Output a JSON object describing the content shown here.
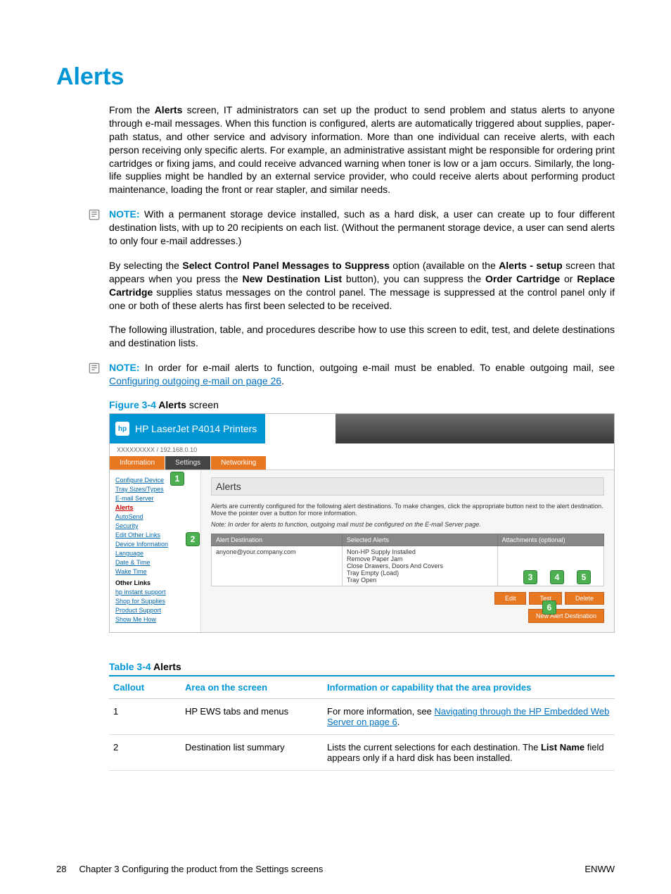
{
  "page_title": "Alerts",
  "paragraphs": {
    "p1_a": "From the ",
    "p1_b": "Alerts",
    "p1_c": " screen, IT administrators can set up the product to send problem and status alerts to anyone through e-mail messages. When this function is configured, alerts are automatically triggered about supplies, paper-path status, and other service and advisory information. More than one individual can receive alerts, with each person receiving only specific alerts. For example, an administrative assistant might be responsible for ordering print cartridges or fixing jams, and could receive advanced warning when toner is low or a jam occurs. Similarly, the long-life supplies might be handled by an external service provider, who could receive alerts about performing product maintenance, loading the front or rear stapler, and similar needs.",
    "note1_label": "NOTE:",
    "note1_text": "  With a permanent storage device installed, such as a hard disk, a user can create up to four different destination lists, with up to 20 recipients on each list. (Without the permanent storage device, a user can send alerts to only four e-mail addresses.)",
    "p2_a": "By selecting the ",
    "p2_b": "Select Control Panel Messages to Suppress",
    "p2_c": " option (available on the ",
    "p2_d": "Alerts - setup",
    "p2_e": " screen that appears when you press the ",
    "p2_f": "New Destination List",
    "p2_g": " button), you can suppress the ",
    "p2_h": "Order Cartridge",
    "p2_i": " or ",
    "p2_j": "Replace Cartridge",
    "p2_k": " supplies status messages on the control panel. The message is suppressed at the control panel only if one or both of these alerts has first been selected to be received.",
    "p3": "The following illustration, table, and procedures describe how to use this screen to edit, test, and delete destinations and destination lists.",
    "note2_label": "NOTE:",
    "note2_text_a": "  In order for e-mail alerts to function, outgoing e-mail must be enabled. To enable outgoing mail, see ",
    "note2_link": "Configuring outgoing e-mail on page 26",
    "note2_text_b": "."
  },
  "figure": {
    "num": "Figure 3-4",
    "title": " Alerts",
    "suffix": " screen"
  },
  "ews": {
    "brand": "HP LaserJet P4014 Printers",
    "sub": "XXXXXXXXX / 192.168.0.10",
    "tabs": {
      "info": "Information",
      "settings": "Settings",
      "net": "Networking"
    },
    "side": [
      "Configure Device",
      "Tray Sizes/Types",
      "E-mail Server",
      "Alerts",
      "AutoSend",
      "Security",
      "Edit Other Links",
      "Device Information",
      "Language",
      "Date & Time",
      "Wake Time"
    ],
    "side_heading": "Other Links",
    "side2": [
      "hp instant support",
      "Shop for Supplies",
      "Product Support",
      "Show Me How"
    ],
    "main_title": "Alerts",
    "intro": "Alerts are currently configured for the following alert destinations. To make changes, click the appropriate button next to the alert destination. Move the pointer over a button for more information.",
    "note": "Note: In order for alerts to function, outgoing mail must be configured on the E-mail Server page.",
    "th1": "Alert Destination",
    "th2": "Selected Alerts",
    "th3": "Attachments (optional)",
    "dest": "anyone@your.company.com",
    "sel_alerts": [
      "Non-HP Supply Installed",
      "Remove Paper Jam",
      "Close Drawers, Doors And Covers",
      "Tray Empty (Load)",
      "Tray Open"
    ],
    "btn_edit": "Edit",
    "btn_test": "Test",
    "btn_delete": "Delete",
    "btn_new": "New Alert Destination"
  },
  "chart_data": {
    "type": "table",
    "title": "Table 3-4 Alerts",
    "columns": [
      "Callout",
      "Area on the screen",
      "Information or capability that the area provides"
    ],
    "rows": [
      {
        "callout": "1",
        "area": "HP EWS tabs and menus",
        "info_a": "For more information, see ",
        "link": "Navigating through the HP Embedded Web Server on page 6",
        "info_b": "."
      },
      {
        "callout": "2",
        "area": "Destination list summary",
        "info_a": "Lists the current selections for each destination. The ",
        "bold": "List Name",
        "info_b": " field appears only if a hard disk has been installed."
      }
    ]
  },
  "table_caption": {
    "num": "Table 3-4",
    "title": " Alerts"
  },
  "footer": {
    "left_page": "28",
    "left_text": "Chapter 3   Configuring the product from the Settings screens",
    "right": "ENWW"
  }
}
